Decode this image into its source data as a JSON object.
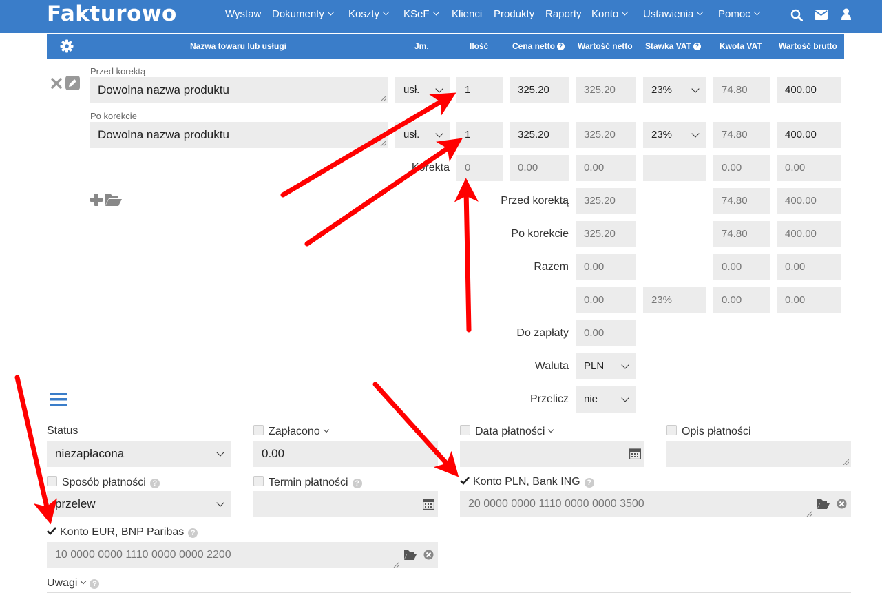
{
  "app": {
    "logo": "Fakturowo"
  },
  "nav": {
    "items": [
      {
        "label": "Wystaw"
      },
      {
        "label": "Dokumenty"
      },
      {
        "label": "Koszty"
      },
      {
        "label": "KSeF"
      },
      {
        "label": "Klienci"
      },
      {
        "label": "Produkty"
      },
      {
        "label": "Raporty"
      },
      {
        "label": "Konto"
      },
      {
        "label": "Ustawienia"
      },
      {
        "label": "Pomoc"
      }
    ],
    "icons": [
      "search-icon",
      "envelope-icon",
      "user-icon"
    ]
  },
  "table": {
    "headers": {
      "name": "Nazwa towaru lub usługi",
      "unit": "Jm.",
      "qty": "Ilość",
      "net_price": "Cena netto",
      "net_value": "Wartość netto",
      "vat_rate": "Stawka VAT",
      "vat_amount": "Kwota VAT",
      "gross_value": "Wartość brutto"
    },
    "before": {
      "label": "Przed korektą",
      "name": "Dowolna nazwa produktu",
      "unit": "usł.",
      "qty": "1",
      "net_price": "325.20",
      "net_value": "325.20",
      "vat_rate": "23%",
      "vat_amount": "74.80",
      "gross_value": "400.00"
    },
    "after": {
      "label": "Po korekcie",
      "name": "Dowolna nazwa produktu",
      "unit": "usł.",
      "qty": "1",
      "net_price": "325.20",
      "net_value": "325.20",
      "vat_rate": "23%",
      "vat_amount": "74.80",
      "gross_value": "400.00"
    },
    "correction": {
      "label": "Korekta",
      "qty": "0",
      "net_price": "0.00",
      "net_value": "0.00",
      "vat_amount": "0.00",
      "gross_value": "0.00"
    }
  },
  "summary": {
    "before": {
      "label": "Przed korektą",
      "net": "325.20",
      "vat": "74.80",
      "gross": "400.00"
    },
    "after": {
      "label": "Po korekcie",
      "net": "325.20",
      "vat": "74.80",
      "gross": "400.00"
    },
    "total": {
      "label": "Razem",
      "net": "0.00",
      "vat": "0.00",
      "gross": "0.00"
    },
    "rate_row": {
      "net": "0.00",
      "rate": "23%",
      "vat": "0.00",
      "gross": "0.00"
    },
    "to_pay": {
      "label": "Do zapłaty",
      "value": "0.00"
    },
    "currency": {
      "label": "Waluta",
      "value": "PLN"
    },
    "convert": {
      "label": "Przelicz",
      "value": "nie"
    }
  },
  "payment": {
    "status": {
      "label": "Status",
      "value": "niezapłacona"
    },
    "paid": {
      "label": "Zapłacono",
      "value": "0.00"
    },
    "pay_date": {
      "label": "Data płatności",
      "value": ""
    },
    "pay_desc": {
      "label": "Opis płatności",
      "value": ""
    },
    "method": {
      "label": "Sposób płatności",
      "value": "przelew"
    },
    "term": {
      "label": "Termin płatności",
      "value": ""
    },
    "account_pln": {
      "label": "Konto PLN, Bank ING",
      "value": "20 0000 0000 1110 0000 0000 3500",
      "checked": true
    },
    "account_eur": {
      "label": "Konto EUR, BNP Paribas",
      "value": "10 0000 0000 1110 0000 0000 2200",
      "checked": true
    },
    "notes": {
      "label": "Uwagi"
    }
  },
  "colors": {
    "brand": "#3a7dc9",
    "field_bg": "#ececec",
    "arrow": "#ff0000"
  }
}
